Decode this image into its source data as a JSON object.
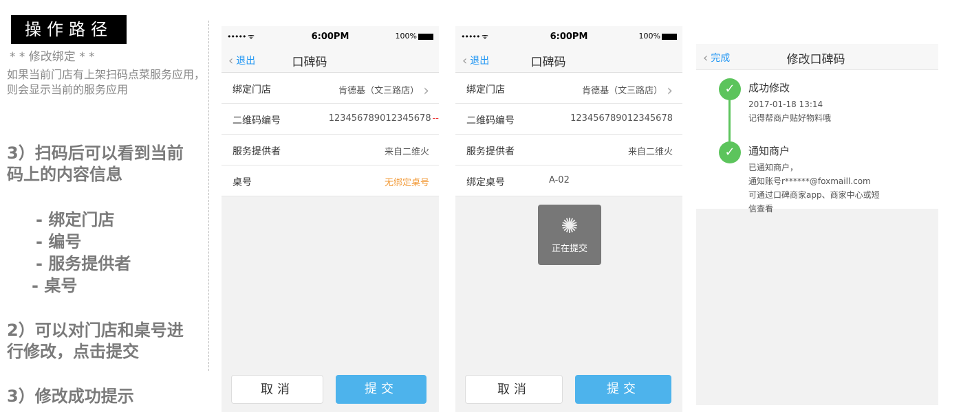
{
  "left": {
    "op_title": "操作路径",
    "note_head": "* * 修改绑定 * *",
    "note_body": "如果当前门店有上架扫码点菜服务应用，则会显示当前的服务应用",
    "step3a": "3）扫码后可以看到当前码上的内容信息",
    "bullets": [
      "- 绑定门店",
      "- 编号",
      "- 服务提供者",
      "-  桌号"
    ],
    "step2": "2）可以对门店和桌号进行修改，点击提交",
    "step3b": "3）修改成功提示"
  },
  "status": {
    "signal": "••••• ᯤ",
    "time": "6:00PM",
    "battery": "100%"
  },
  "screen1": {
    "back": "退出",
    "title": "口碑码",
    "rows": [
      {
        "label": "绑定门店",
        "value": "肯德基（文三路店）"
      },
      {
        "label": "二维码编号",
        "value": "1234567890123456​78"
      },
      {
        "label": "服务提供者",
        "value": "来自二维火"
      },
      {
        "label": "桌号",
        "value": "无绑定桌号"
      }
    ],
    "cancel": "取消",
    "submit": "提交"
  },
  "screen2": {
    "back": "退出",
    "title": "口碑码",
    "rows": [
      {
        "label": "绑定门店",
        "value": "肯德基（文三路店）"
      },
      {
        "label": "二维码编号",
        "value": "123456789012345678"
      },
      {
        "label": "服务提供者",
        "value": "来自二维火"
      },
      {
        "label": "绑定桌号",
        "value": "A-02"
      }
    ],
    "toast": "正在提交",
    "cancel": "取消",
    "submit": "提交"
  },
  "screen3": {
    "back": "完成",
    "title": "修改口碑码",
    "step1_title": "成功修改",
    "step1_time": "2017-01-18  13:14",
    "step1_desc": "记得帮商户贴好物料哦",
    "step2_title": "通知商户",
    "step2_l1": "已通知商户，",
    "step2_l2": "通知账号r******@foxmaill.com",
    "step2_l3": "可通过口碑商家app、商家中心或短",
    "step2_l4": "信查看"
  }
}
